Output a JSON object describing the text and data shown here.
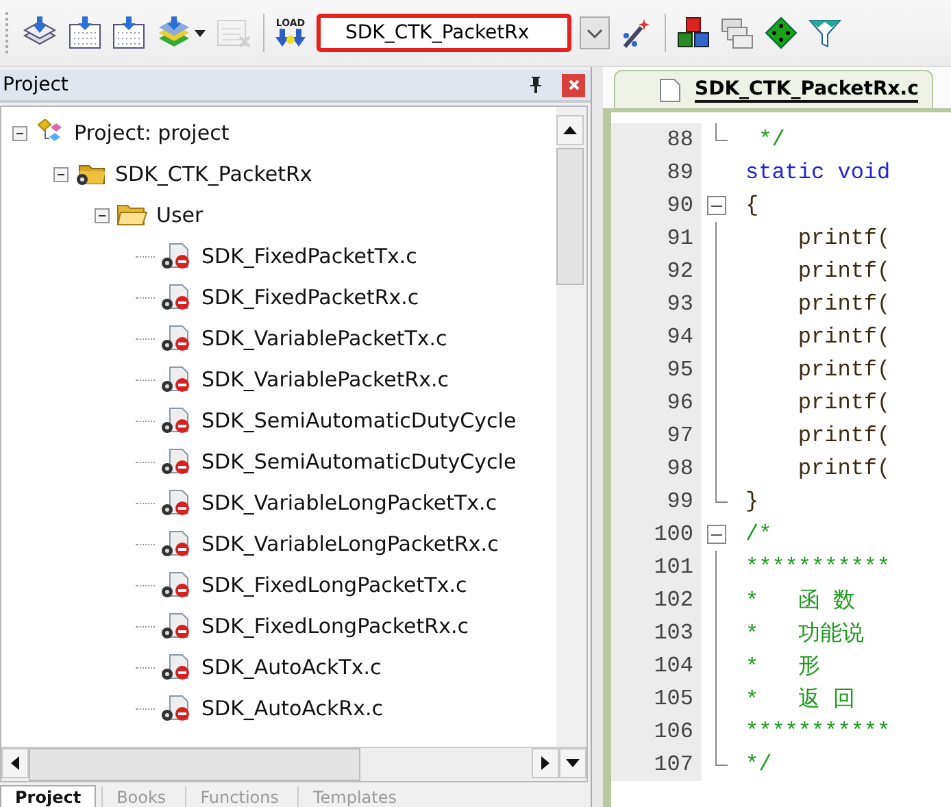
{
  "toolbar": {
    "items": [
      {
        "kind": "icon"
      },
      {
        "kind": "icon"
      },
      {
        "kind": "icon"
      },
      {
        "kind": "icon"
      },
      {
        "kind": "caret"
      },
      {
        "kind": "icon",
        "disabled": true
      },
      {
        "kind": "sep"
      },
      {
        "kind": "load",
        "label": "LOAD"
      }
    ],
    "target": {
      "value": "SDK_CTK_PacketRx",
      "highlighted": true
    },
    "items_after": [
      {
        "kind": "icon"
      },
      {
        "kind": "sep"
      },
      {
        "kind": "icon"
      },
      {
        "kind": "icon"
      },
      {
        "kind": "icon"
      },
      {
        "kind": "icon"
      }
    ]
  },
  "project_panel": {
    "title": "Project",
    "tree": [
      {
        "label": "Project: project",
        "kind": "project",
        "expanded": true,
        "children": [
          {
            "label": "SDK_CTK_PacketRx",
            "kind": "target",
            "expanded": true,
            "children": [
              {
                "label": "User",
                "kind": "folder",
                "expanded": true,
                "children": [
                  {
                    "label": "SDK_FixedPacketTx.c",
                    "kind": "file"
                  },
                  {
                    "label": "SDK_FixedPacketRx.c",
                    "kind": "file"
                  },
                  {
                    "label": "SDK_VariablePacketTx.c",
                    "kind": "file"
                  },
                  {
                    "label": "SDK_VariablePacketRx.c",
                    "kind": "file"
                  },
                  {
                    "label": "SDK_SemiAutomaticDutyCycle",
                    "kind": "file"
                  },
                  {
                    "label": "SDK_SemiAutomaticDutyCycle",
                    "kind": "file"
                  },
                  {
                    "label": "SDK_VariableLongPacketTx.c",
                    "kind": "file"
                  },
                  {
                    "label": "SDK_VariableLongPacketRx.c",
                    "kind": "file"
                  },
                  {
                    "label": "SDK_FixedLongPacketTx.c",
                    "kind": "file"
                  },
                  {
                    "label": "SDK_FixedLongPacketRx.c",
                    "kind": "file"
                  },
                  {
                    "label": "SDK_AutoAckTx.c",
                    "kind": "file"
                  },
                  {
                    "label": "SDK_AutoAckRx.c",
                    "kind": "file"
                  }
                ]
              }
            ]
          }
        ]
      }
    ],
    "tabs": [
      {
        "label": "Project",
        "selected": true
      },
      {
        "label": "Books",
        "selected": false
      },
      {
        "label": "Functions",
        "selected": false
      },
      {
        "label": "Templates",
        "selected": false
      }
    ]
  },
  "editor": {
    "tabs": [
      {
        "label": "SDK_CTK_PacketRx.c",
        "selected": true
      }
    ],
    "lines": [
      {
        "number": "88",
        "kind": "comment",
        "text": " */",
        "fold": {
          "kind": "end"
        }
      },
      {
        "number": "89",
        "kind": "keyword",
        "text": "static void"
      },
      {
        "number": "90",
        "kind": "code",
        "text": "{",
        "fold": {
          "kind": "start"
        }
      },
      {
        "number": "91",
        "kind": "code",
        "text": "    printf(",
        "fold": {
          "kind": "mid"
        }
      },
      {
        "number": "92",
        "kind": "code",
        "text": "    printf(",
        "fold": {
          "kind": "mid"
        }
      },
      {
        "number": "93",
        "kind": "code",
        "text": "    printf(",
        "fold": {
          "kind": "mid"
        }
      },
      {
        "number": "94",
        "kind": "code",
        "text": "    printf(",
        "fold": {
          "kind": "mid"
        }
      },
      {
        "number": "95",
        "kind": "code",
        "text": "    printf(",
        "fold": {
          "kind": "mid"
        }
      },
      {
        "number": "96",
        "kind": "code",
        "text": "    printf(",
        "fold": {
          "kind": "mid"
        }
      },
      {
        "number": "97",
        "kind": "code",
        "text": "    printf(",
        "fold": {
          "kind": "mid"
        }
      },
      {
        "number": "98",
        "kind": "code",
        "text": "    printf(",
        "fold": {
          "kind": "mid"
        }
      },
      {
        "number": "99",
        "kind": "code",
        "text": "}",
        "fold": {
          "kind": "end"
        }
      },
      {
        "number": "100",
        "kind": "comment",
        "text": "/*",
        "fold": {
          "kind": "start"
        }
      },
      {
        "number": "101",
        "kind": "comment",
        "text": "***********",
        "fold": {
          "kind": "mid"
        }
      },
      {
        "number": "102",
        "kind": "comment",
        "text": "*   函 数",
        "fold": {
          "kind": "mid"
        }
      },
      {
        "number": "103",
        "kind": "comment",
        "text": "*   功能说",
        "fold": {
          "kind": "mid"
        }
      },
      {
        "number": "104",
        "kind": "comment",
        "text": "*   形",
        "fold": {
          "kind": "mid"
        }
      },
      {
        "number": "105",
        "kind": "comment",
        "text": "*   返 回",
        "fold": {
          "kind": "mid"
        }
      },
      {
        "number": "106",
        "kind": "comment",
        "text": "***********",
        "fold": {
          "kind": "mid"
        }
      },
      {
        "number": "107",
        "kind": "comment",
        "text": "*/",
        "fold": {
          "kind": "end"
        }
      }
    ]
  }
}
